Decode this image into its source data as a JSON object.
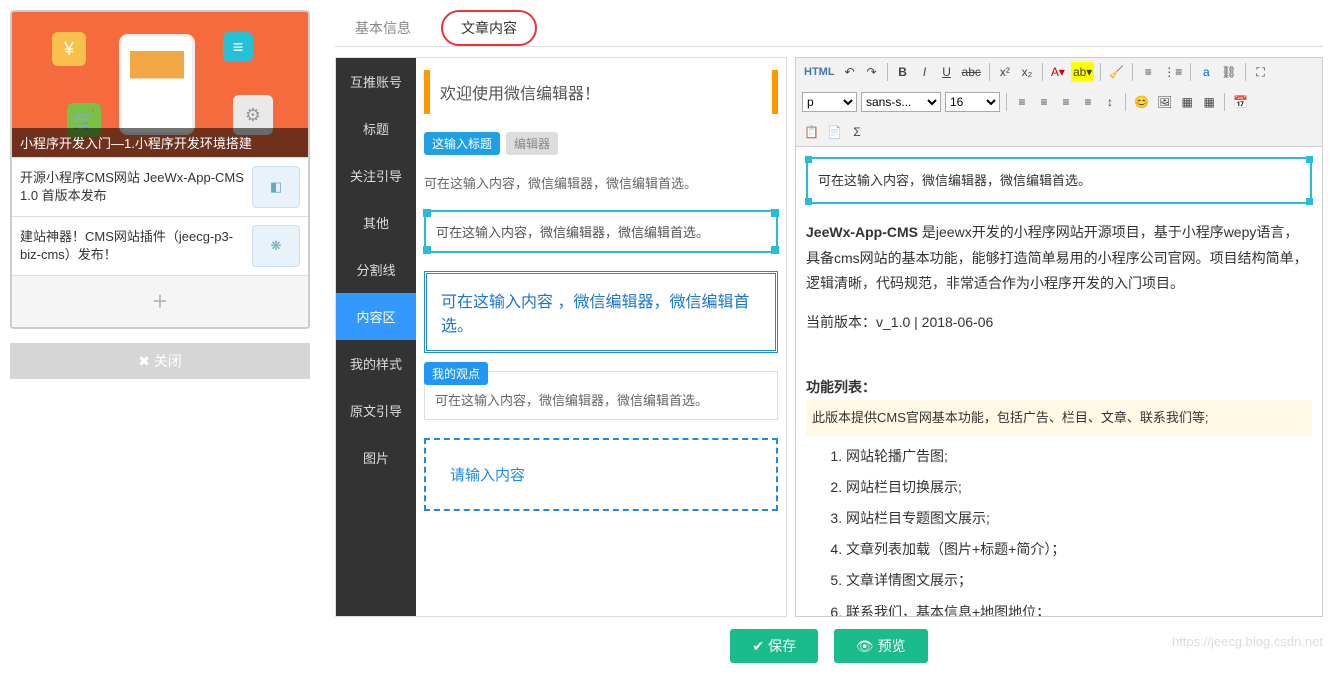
{
  "leftPanel": {
    "heroCaption": "小程序开发入门—1.小程序开发环境搭建",
    "items": [
      "开源小程序CMS网站 JeeWx-App-CMS 1.0 首版本发布",
      "建站神器！CMS网站插件（jeecg-p3-biz-cms）发布！"
    ],
    "addLabel": "+",
    "closeLabel": "关闭"
  },
  "tabs": {
    "basic": "基本信息",
    "content": "文章内容"
  },
  "categories": [
    "互推账号",
    "标题",
    "关注引导",
    "其他",
    "分割线",
    "内容区",
    "我的样式",
    "原文引导",
    "图片"
  ],
  "templates": {
    "welcome": "欢迎使用微信编辑器！",
    "tagTitle": "这输入标题",
    "tagEditor": "编辑器",
    "sample": "可在这输入内容，微信编辑器，微信编辑首选。",
    "dbl": "可在这输入内容 ，微信编辑器，微信编辑首选。",
    "myview": "我的观点",
    "dashed": "请输入内容"
  },
  "toolbar": {
    "fontFamily": "sans-s...",
    "fontSize": "16",
    "paragraph": "p"
  },
  "article": {
    "box": "可在这输入内容，微信编辑器，微信编辑首选。",
    "p1": "JeeWx-App-CMS 是jeewx开发的小程序网站开源项目，基于小程序wepy语言，具备cms网站的基本功能，能够打造简单易用的小程序公司官网。项目结构简单，逻辑清晰，代码规范，非常适合作为小程序开发的入门项目。",
    "ver": "当前版本：v_1.0 | 2018-06-06",
    "listTitle": "功能列表：",
    "yellow": "此版本提供CMS官网基本功能，包括广告、栏目、文章、联系我们等;",
    "features": [
      "网站轮播广告图;",
      "网站栏目切换展示;",
      "网站栏目专题图文展示;",
      "文章列表加载（图片+标题+简介）；",
      "文章详情图文展示；",
      "联系我们，基本信息+地图地位；"
    ]
  },
  "buttons": {
    "save": "保存",
    "preview": "预览"
  },
  "watermark": "https://jeecg.blog.csdn.net"
}
